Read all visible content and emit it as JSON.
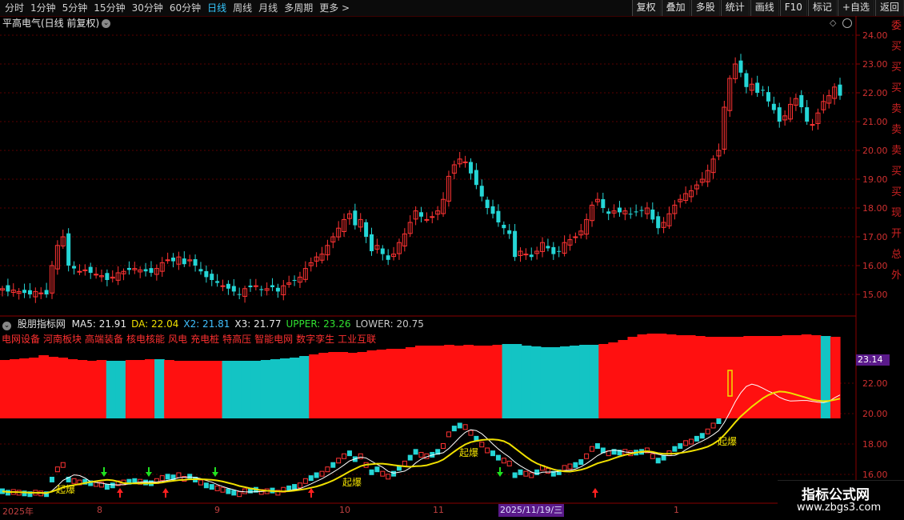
{
  "toolbar": {
    "periods": [
      "分时",
      "1分钟",
      "5分钟",
      "15分钟",
      "30分钟",
      "60分钟",
      "日线",
      "周线",
      "月线",
      "多周期",
      "更多 >"
    ],
    "active_index": 6,
    "actions": [
      "复权",
      "叠加",
      "多股",
      "统计",
      "画线",
      "F10",
      "标记",
      "+自选",
      "返回"
    ]
  },
  "main_title": "平高电气(日线 前复权)",
  "indicator": {
    "name": "股朋指标网",
    "items": [
      {
        "label": "MA5: 21.91",
        "color": "#e8e8e8"
      },
      {
        "label": "DA: 22.04",
        "color": "#f0e000"
      },
      {
        "label": "X2: 21.81",
        "color": "#40c0ff"
      },
      {
        "label": "X3: 21.77",
        "color": "#e8e8e8"
      },
      {
        "label": "UPPER: 23.26",
        "color": "#30e030"
      },
      {
        "label": "LOWER: 20.75",
        "color": "#c8c8c8"
      }
    ]
  },
  "concepts": [
    "电网设备",
    "河南板块",
    "高端装备",
    "核电核能",
    "风电",
    "充电桩",
    "特高压",
    "智能电网",
    "数字孪生",
    "工业互联"
  ],
  "price_axis": [
    "24.00",
    "23.00",
    "22.00",
    "21.00",
    "20.00",
    "19.00",
    "18.00",
    "17.00",
    "16.00",
    "15.00"
  ],
  "sub_axis": [
    "22.00",
    "20.00",
    "18.00",
    "16.00"
  ],
  "sub_price_tag": "23.14",
  "dates": [
    "2025年",
    "8",
    "9",
    "10",
    "11",
    "1"
  ],
  "date_cursor": "2025/11/19/三",
  "markers": {
    "burst": "起爆"
  },
  "right_edge_text": "委买买买卖卖卖买买现开总外",
  "watermark": {
    "line1": "指标公式网",
    "line2": "www.zbgs3.com"
  },
  "colors": {
    "up": "#ff3333",
    "down": "#25d6d6",
    "grid": "#5a0000",
    "ma_yellow": "#f0e000",
    "ma_white": "#ffffff",
    "band": "#ff1010",
    "band_alt": "#13c4c4"
  }
}
